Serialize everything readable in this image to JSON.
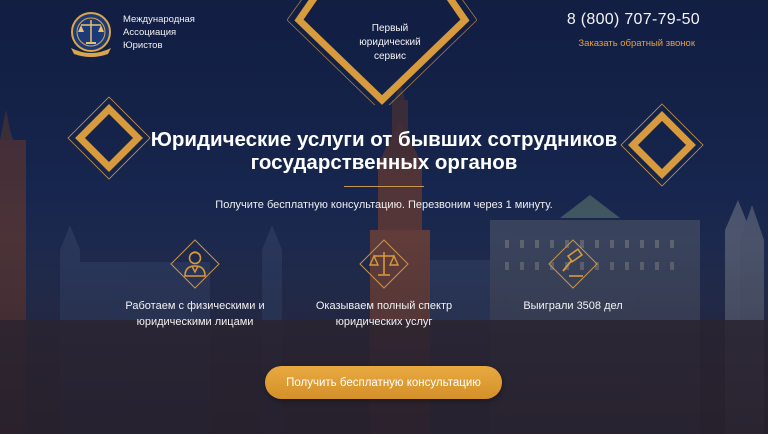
{
  "brand": {
    "logo_icon": "scales-emblem-icon",
    "name_lines": [
      "Международная",
      "Ассоциация",
      "Юристов"
    ]
  },
  "badge": {
    "lines": [
      "Первый",
      "юридический",
      "сервис"
    ]
  },
  "contact": {
    "phone": "8 (800) 707-79-50",
    "callback_label": "Заказать обратный звонок"
  },
  "hero": {
    "title_lines": [
      "Юридические услуги от бывших сотрудников",
      "государственных органов"
    ],
    "subtitle": "Получите бесплатную консультацию. Перезвоним через 1 минуту."
  },
  "features": [
    {
      "icon": "lawyer-icon",
      "lines": [
        "Работаем с физическими и",
        "юридическими лицами"
      ]
    },
    {
      "icon": "scales-icon",
      "lines": [
        "Оказываем полный спектр",
        "юридических услуг"
      ]
    },
    {
      "icon": "gavel-icon",
      "lines": [
        "Выиграли 3508 дел"
      ]
    }
  ],
  "cta": {
    "label": "Получить бесплатную консультацию"
  },
  "colors": {
    "accent": "#d79a3c",
    "accent_dark": "#c08033",
    "background": "#1b2c57"
  }
}
